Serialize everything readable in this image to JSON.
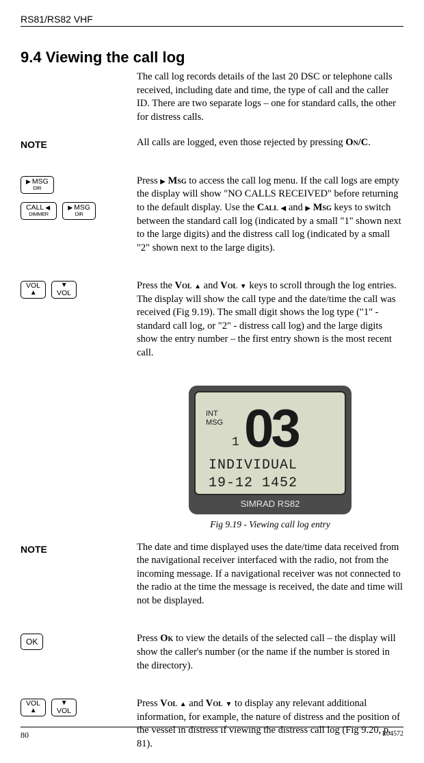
{
  "header": {
    "product": "RS81/RS82 VHF"
  },
  "section": {
    "number_title": "9.4  Viewing the call log"
  },
  "intro": "The call log records details of the last 20 DSC or telephone calls received, including date and time, the type of call and the caller ID. There are two separate logs – one for standard calls, the other for distress calls.",
  "note1": {
    "label": "NOTE",
    "text_pre": "All calls are logged, even those rejected by pressing ",
    "key": "On/C",
    "text_post": "."
  },
  "keys": {
    "msg_top": "MSG",
    "msg_bot": "DIR",
    "call_top": "CALL",
    "call_bot": "DIMMER",
    "vol_label": "VOL",
    "ok_label": "OK"
  },
  "press_msg": {
    "p1_pre": "Press ",
    "p1_key": "Msg",
    "p1_mid": " to access the call log menu. If the call logs are empty the display will show \"NO CALLS RECEIVED\" before returning to the default display. Use the ",
    "p1_call": "Call",
    "p1_and": " and ",
    "p1_msg2": "Msg",
    "p1_end": " keys to switch between the standard call log (indicated by a small \"1\" shown next to the large digits) and the distress call log (indicated by a small \"2\" shown next to the large digits)."
  },
  "press_vol": {
    "pre": "Press the ",
    "vol": "Vol",
    "up_and": " and ",
    "vol2": "Vol",
    "end": " keys to scroll through the log entries. The display will show the call type and the date/time the call was received (Fig 9.19). The small digit shows the log type (\"1\" - standard call log, or \"2\" - distress call log) and the large digits show the entry number – the first entry shown is the most recent call."
  },
  "lcd": {
    "tag1": "INT",
    "tag2": "MSG",
    "big": "03",
    "line1": "INDIVIDUAL",
    "line2": "19-12 1452",
    "brand": "SIMRAD RS82"
  },
  "caption": "Fig 9.19 - Viewing call log entry",
  "note2": {
    "label": "NOTE",
    "text": "The date and time displayed uses the date/time data received from the navigational receiver interfaced with the radio, not from the incoming message. If a navigational receiver was not connected to the radio at the time the message is received, the date and time will not be displayed."
  },
  "press_ok": {
    "pre": "Press ",
    "ok": "Ok",
    "end": " to view the details of the selected call – the display will show the caller's number (or the name if the number is stored in the directory)."
  },
  "press_vol2": {
    "pre": "Press ",
    "vol": "Vol",
    "and": " and ",
    "vol2": "Vol",
    "end": " to display any relevant additional information, for example, the nature of distress and the position of the vessel in distress if viewing the distress call log (Fig 9.20, p. 81)."
  },
  "footer": {
    "page": "80",
    "code": "E04572"
  }
}
